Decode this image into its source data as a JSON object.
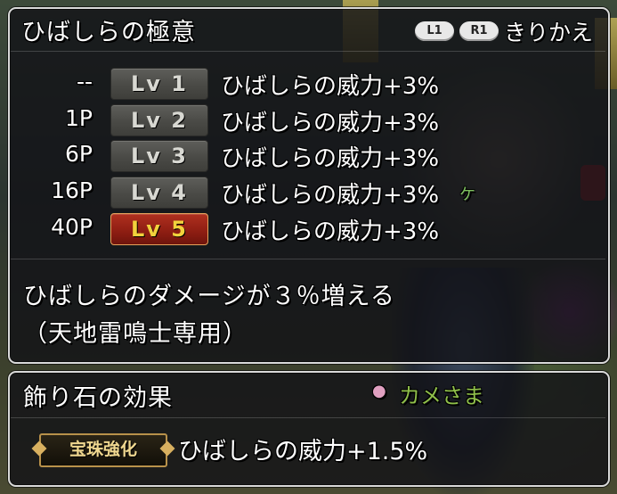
{
  "header": {
    "title": "ひばしらの極意",
    "btn_l1": "L1",
    "btn_r1": "R1",
    "switch_label": "きりかえ"
  },
  "levels": [
    {
      "cost": "--",
      "level": "Lv 1",
      "effect": "ひばしらの威力+3%",
      "active": false
    },
    {
      "cost": "1P",
      "level": "Lv 2",
      "effect": "ひばしらの威力+3%",
      "active": false
    },
    {
      "cost": "6P",
      "level": "Lv 3",
      "effect": "ひばしらの威力+3%",
      "active": false
    },
    {
      "cost": "16P",
      "level": "Lv 4",
      "effect": "ひばしらの威力+3%",
      "active": false
    },
    {
      "cost": "40P",
      "level": "Lv 5",
      "effect": "ひばしらの威力+3%",
      "active": true
    }
  ],
  "description": {
    "line1": "ひばしらのダメージが３％増える",
    "line2": "（天地雷鳴士専用）"
  },
  "jewel": {
    "heading": "飾り石の効果",
    "tag": "宝珠強化",
    "effect": "ひばしらの威力+1.5%"
  },
  "background": {
    "npc_name": "カメさま",
    "stray_char": "ケ"
  },
  "colors": {
    "active_level_bg": "#8d1d12",
    "active_level_text": "#f2d23c",
    "panel_border": "#d9d9d9",
    "npc_name": "#8fbf4a"
  }
}
